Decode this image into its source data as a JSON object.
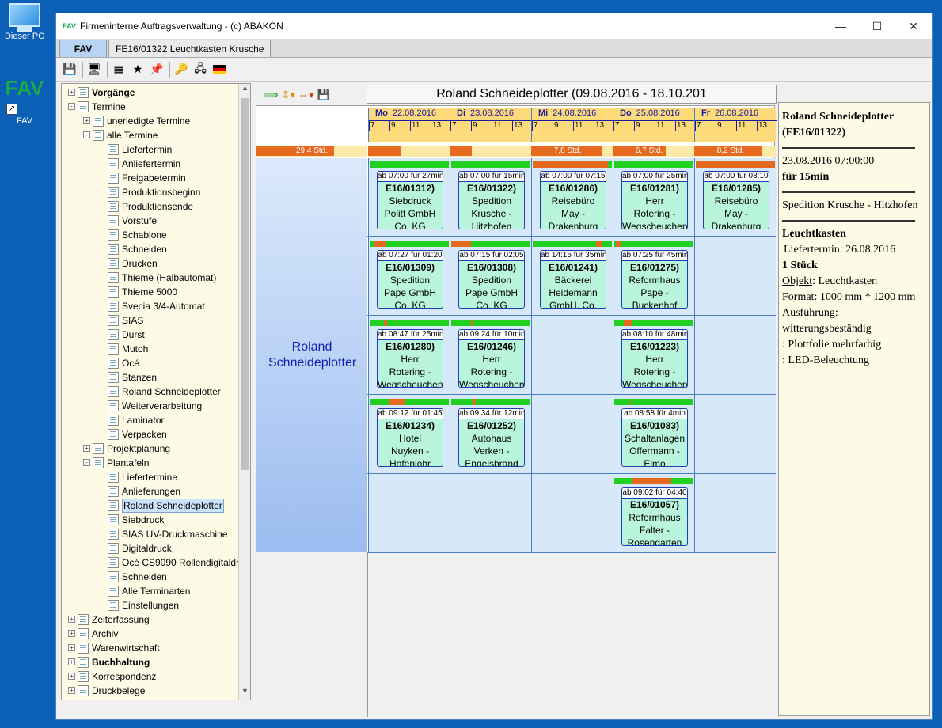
{
  "desktop": {
    "icons": [
      {
        "label": "Dieser PC"
      },
      {
        "label": "FAV",
        "logo": "FAV"
      }
    ]
  },
  "window": {
    "title": "Firmeninterne Auftragsverwaltung - (c) ABAKON",
    "app_icon_text": "FAV",
    "controls": [
      "minimize-icon",
      "maximize-icon",
      "close-icon"
    ]
  },
  "tabs": [
    {
      "label": "FAV",
      "active": true
    },
    {
      "label": "FE16/01322 Leuchtkasten Krusche",
      "active": false
    }
  ],
  "tree": {
    "items": [
      {
        "label": "Vorgänge",
        "level": 0,
        "bold": true,
        "expander": "+"
      },
      {
        "label": "Termine",
        "level": 0,
        "bold": false,
        "expander": "-"
      },
      {
        "label": "unerledigte Termine",
        "level": 1,
        "expander": "+"
      },
      {
        "label": "alle Termine",
        "level": 1,
        "expander": "-"
      },
      {
        "label": "Liefertermin",
        "level": 2
      },
      {
        "label": "Anliefertermin",
        "level": 2
      },
      {
        "label": "Freigabetermin",
        "level": 2
      },
      {
        "label": "Produktionsbeginn",
        "level": 2
      },
      {
        "label": "Produktionsende",
        "level": 2
      },
      {
        "label": "Vorstufe",
        "level": 2
      },
      {
        "label": "Schablone",
        "level": 2
      },
      {
        "label": "Schneiden",
        "level": 2
      },
      {
        "label": "Drucken",
        "level": 2
      },
      {
        "label": "Thieme (Halbautomat)",
        "level": 2
      },
      {
        "label": "Thieme 5000",
        "level": 2
      },
      {
        "label": "Svecia 3/4-Automat",
        "level": 2
      },
      {
        "label": "SIAS",
        "level": 2
      },
      {
        "label": "Durst",
        "level": 2
      },
      {
        "label": "Mutoh",
        "level": 2
      },
      {
        "label": "Océ",
        "level": 2
      },
      {
        "label": "Stanzen",
        "level": 2
      },
      {
        "label": "Roland Schneideplotter",
        "level": 2
      },
      {
        "label": "Weiterverarbeitung",
        "level": 2
      },
      {
        "label": "Laminator",
        "level": 2
      },
      {
        "label": "Verpacken",
        "level": 2
      },
      {
        "label": "Projektplanung",
        "level": 1,
        "expander": "+"
      },
      {
        "label": "Plantafeln",
        "level": 1,
        "expander": "-"
      },
      {
        "label": "Liefertermine",
        "level": 2
      },
      {
        "label": "Anlieferungen",
        "level": 2
      },
      {
        "label": "Roland Schneideplotter",
        "level": 2,
        "selected": true
      },
      {
        "label": "Siebdruck",
        "level": 2
      },
      {
        "label": "SIAS UV-Druckmaschine",
        "level": 2
      },
      {
        "label": "Digitaldruck",
        "level": 2
      },
      {
        "label": "Océ CS9090 Rollendigitaldr",
        "level": 2
      },
      {
        "label": "Schneiden",
        "level": 2
      },
      {
        "label": "Alle Terminarten",
        "level": 2
      },
      {
        "label": "Einstellungen",
        "level": 2
      },
      {
        "label": "Zeiterfassung",
        "level": 0,
        "expander": "+"
      },
      {
        "label": "Archiv",
        "level": 0,
        "expander": "+"
      },
      {
        "label": "Warenwirtschaft",
        "level": 0,
        "expander": "+"
      },
      {
        "label": "Buchhaltung",
        "level": 0,
        "bold": true,
        "expander": "+"
      },
      {
        "label": "Korrespondenz",
        "level": 0,
        "expander": "+"
      },
      {
        "label": "Druckbelege",
        "level": 0,
        "expander": "+"
      }
    ]
  },
  "planner": {
    "title": "Roland Schneideplotter (09.08.2016 - 18.10.201",
    "resource": "Roland Schneideplotter",
    "resource_hours": "29,4 Std.",
    "resource_load": 0.7,
    "hours": [
      "7",
      "9",
      "11",
      "13"
    ],
    "days": [
      {
        "dow": "Mo",
        "date": "22.08.2016",
        "load_text": "",
        "load": 0.45
      },
      {
        "dow": "Di",
        "date": "23.08.2016",
        "load_text": "",
        "load": 0.3
      },
      {
        "dow": "Mi",
        "date": "24.08.2016",
        "load_text": "7,8 Std.",
        "load": 0.97
      },
      {
        "dow": "Do",
        "date": "25.08.2016",
        "load_text": "6,7 Std.",
        "load": 0.73
      },
      {
        "dow": "Fr",
        "date": "26.08.2016",
        "load_text": "8,2 Std.",
        "load": 0.92
      }
    ],
    "appointments": [
      {
        "row": 0,
        "day": 0,
        "time": "ab 07:00 für 27min",
        "no": "E16/01312)",
        "c1": "Siebdruck",
        "c2": "Politt GmbH",
        "c3": "Co. KG",
        "bar": [
          [
            0,
            0
          ]
        ]
      },
      {
        "row": 0,
        "day": 1,
        "time": "ab 07:00 für 15min",
        "no": "E16/01322)",
        "c1": "Spedition",
        "c2": "Krusche -",
        "c3": "Hitzhofen",
        "bar": [
          [
            0,
            0
          ]
        ]
      },
      {
        "row": 0,
        "day": 2,
        "time": "ab 07:00 für 07:15",
        "no": "E16/01286)",
        "c1": "Reisebüro",
        "c2": "May -",
        "c3": "Drakenburg",
        "bar": [
          [
            0,
            0.95
          ]
        ]
      },
      {
        "row": 0,
        "day": 3,
        "time": "ab 07:00 für 25min",
        "no": "E16/01281)",
        "c1": "Herr",
        "c2": "Rotering -",
        "c3": "Wegscheuchen",
        "bar": [
          [
            0,
            0
          ]
        ]
      },
      {
        "row": 0,
        "day": 4,
        "time": "ab 07:00 für 08:10",
        "no": "E16/01285)",
        "c1": "Reisebüro",
        "c2": "May -",
        "c3": "Drakenburg",
        "bar": [
          [
            0,
            1
          ]
        ]
      },
      {
        "row": 1,
        "day": 0,
        "time": "ab 07:27 für 01:20",
        "no": "E16/01309)",
        "c1": "Spedition",
        "c2": "Pape GmbH",
        "c3": "Co. KG",
        "bar": [
          [
            0.05,
            0.2
          ]
        ]
      },
      {
        "row": 1,
        "day": 1,
        "time": "ab 07:15 für 02:05",
        "no": "E16/01308)",
        "c1": "Spedition",
        "c2": "Pape GmbH",
        "c3": "Co. KG",
        "bar": [
          [
            0,
            0.25
          ]
        ]
      },
      {
        "row": 1,
        "day": 2,
        "time": "ab 14:15 für 35min",
        "no": "E16/01241)",
        "c1": "Bäckerei",
        "c2": "Heidemann",
        "c3": "GmbH, Co.",
        "bar": [
          [
            0.8,
            0.87
          ]
        ]
      },
      {
        "row": 1,
        "day": 3,
        "time": "ab 07:25 für 45min",
        "no": "E16/01275)",
        "c1": "Reformhaus",
        "c2": "Pape -",
        "c3": "Buckenhof",
        "bar": [
          [
            0.02,
            0.08
          ]
        ]
      },
      {
        "row": 2,
        "day": 0,
        "time": "ab 08:47 für 25min",
        "no": "E16/01280)",
        "c1": "Herr",
        "c2": "Rotering -",
        "c3": "Wegscheuchen",
        "bar": [
          [
            0.18,
            0.22
          ]
        ]
      },
      {
        "row": 2,
        "day": 1,
        "time": "ab 09:24 für 10min",
        "no": "E16/01246)",
        "c1": "Herr",
        "c2": "Rotering -",
        "c3": "Wegscheuchen",
        "bar": [
          [
            0.25,
            0.27
          ]
        ]
      },
      {
        "row": 2,
        "day": 3,
        "time": "ab 08:10 für 48min",
        "no": "E16/01223)",
        "c1": "Herr",
        "c2": "Rotering -",
        "c3": "Wegscheuchen",
        "bar": [
          [
            0.12,
            0.22
          ]
        ]
      },
      {
        "row": 3,
        "day": 0,
        "time": "ab 09:12 für 01:45",
        "no": "E16/01234)",
        "c1": "Hotel",
        "c2": "Nuyken -",
        "c3": "Hofenlohr",
        "bar": [
          [
            0.24,
            0.45
          ]
        ]
      },
      {
        "row": 3,
        "day": 1,
        "time": "ab 09:34 für 12min",
        "no": "E16/01252)",
        "c1": "Autohaus",
        "c2": "Verken -",
        "c3": "Engelsbrand",
        "bar": [
          [
            0.28,
            0.31
          ]
        ]
      },
      {
        "row": 3,
        "day": 3,
        "time": "ab 08:58 für 4min",
        "no": "E16/01083)",
        "c1": "Schaltanlagen",
        "c2": "Offermann -",
        "c3": "Eimo",
        "bar": [
          [
            0.2,
            0.21
          ]
        ]
      },
      {
        "row": 4,
        "day": 3,
        "time": "ab 09:02 für 04:40",
        "no": "E16/01057)",
        "c1": "Reformhaus",
        "c2": "Falter -",
        "c3": "Rosengarten",
        "bar": [
          [
            0.22,
            0.72
          ]
        ]
      }
    ]
  },
  "detail": {
    "heading": "Roland Schneideplotter (FE16/01322)",
    "datetime": "23.08.2016 07:00:00",
    "duration": "für 15min",
    "customer": "Spedition Krusche - Hitzhofen",
    "product": "Leuchtkasten",
    "delivery": "Liefertermin:  26.08.2016",
    "qty": "1 Stück",
    "object_label": "Objekt",
    "object_value": ": Leuchtkasten",
    "format_label": "Format",
    "format_value": ": 1000 mm * 1200 mm",
    "execution_label": "Ausführung:",
    "execution_lines": [
      "witterungsbeständig",
      ": Plottfolie mehrfarbig",
      ": LED-Beleuchtung"
    ]
  },
  "colors": {
    "accent": "#4a7fc1",
    "load_fill": "#e5691e",
    "free_bar": "#22d022",
    "appointment": "#b9f5dc",
    "tree_bg": "#fdfbe6"
  }
}
